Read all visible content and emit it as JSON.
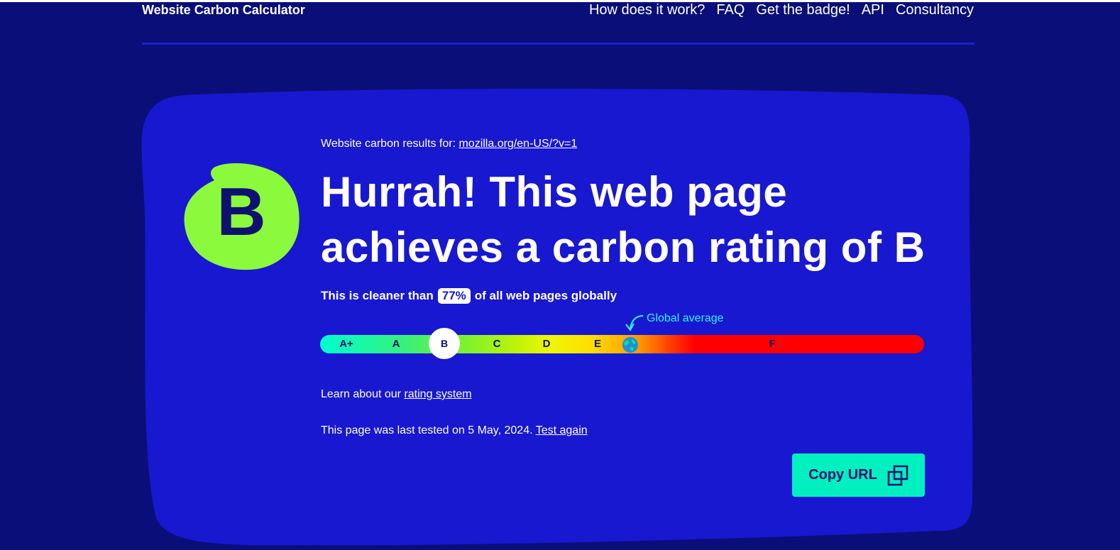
{
  "header": {
    "brand": "Website Carbon Calculator",
    "nav": [
      "How does it work?",
      "FAQ",
      "Get the badge!",
      "API",
      "Consultancy"
    ]
  },
  "results": {
    "prefix": "Website carbon results for:",
    "url": "mozilla.org/en-US/?v=1"
  },
  "grade": {
    "letter": "B",
    "headline": "Hurrah! This web page achieves a carbon rating of B"
  },
  "cleaner": {
    "before": "This is cleaner than",
    "percent": "77%",
    "after": "of all web pages globally"
  },
  "scale": {
    "global_average_label": "Global average",
    "labels": [
      "A+",
      "A",
      "B",
      "C",
      "D",
      "E",
      "F"
    ],
    "current": "B"
  },
  "links": {
    "learn_prefix": "Learn about our",
    "learn_link": "rating system",
    "tested_prefix": "This page was last tested on 5 May, 2024.",
    "tested_link": "Test again"
  },
  "copy_button": {
    "label": "Copy URL"
  },
  "colors": {
    "background": "#0a0e78",
    "card": "#1818d0",
    "grade_blob": "#8cfa3c",
    "accent": "#00f0c0",
    "global_avg": "#2ef5f0"
  },
  "icons": [
    "copy-icon",
    "globe-icon",
    "curved-arrow-icon"
  ]
}
